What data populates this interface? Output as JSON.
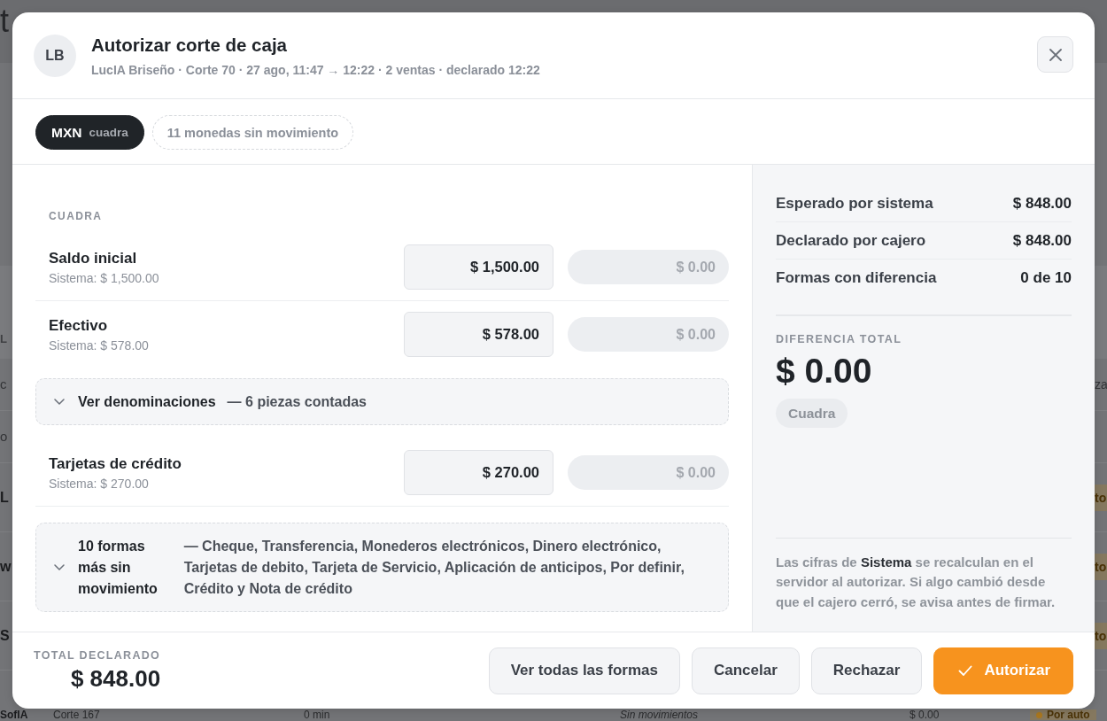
{
  "background_page": {
    "title": "t",
    "column_header": "L",
    "rows": [
      {
        "kind": "plain",
        "name": "c",
        "end": "za"
      },
      {
        "kind": "plain",
        "name": "o"
      },
      {
        "kind": "pending",
        "name": "L",
        "status": "to"
      },
      {
        "kind": "pending",
        "name": "w",
        "status": "to"
      },
      {
        "kind": "pending",
        "name": "S",
        "status": "to"
      },
      {
        "kind": "detailed",
        "name": "SofIA",
        "corte": "Corte 167",
        "duration": "0 min",
        "movements": "Sin movimientos",
        "amount": "$ 0.00",
        "status": "Por auto"
      }
    ]
  },
  "dialog": {
    "avatar": "LB",
    "title": "Autorizar corte de caja",
    "subtitle": "LucIA Briseño · Corte 70 · 27 ago, 11:47 → 12:22 · 2 ventas · declarado 12:22"
  },
  "currency_tabs": [
    {
      "kind": "currency",
      "code": "MXN",
      "status": "cuadra",
      "selected": true
    },
    {
      "kind": "collapsed",
      "label": "11 monedas sin movimiento",
      "selected": false
    }
  ],
  "breakdown": {
    "heading": "CUADRA",
    "items": [
      {
        "kind": "payment",
        "name": "Saldo inicial",
        "system": "Sistema: $ 1,500.00",
        "declared": "$ 1,500.00",
        "difference": "$ 0.00"
      },
      {
        "kind": "payment",
        "name": "Efectivo",
        "system": "Sistema: $ 578.00",
        "declared": "$ 578.00",
        "difference": "$ 0.00",
        "denominations": {
          "title": "Ver denominaciones",
          "summary": "— 6 piezas contadas",
          "expanded": false
        }
      },
      {
        "kind": "payment",
        "name": "Tarjetas de crédito",
        "system": "Sistema: $ 270.00",
        "declared": "$ 270.00",
        "difference": "$ 0.00"
      },
      {
        "kind": "details",
        "title": "10 formas más sin movimiento",
        "summary": "— Cheque, Transferencia, Monederos electrónicos, Dinero electrónico, Tarjetas de debito, Tarjeta de Servicio, Aplicación de anticipos, Por definir, Crédito y Nota de crédito",
        "expanded": false
      }
    ]
  },
  "summary": {
    "rows": [
      {
        "label": "Esperado por sistema",
        "value": "$ 848.00"
      },
      {
        "label": "Declarado por cajero",
        "value": "$ 848.00"
      },
      {
        "label": "Formas con diferencia",
        "value": "0 de 10"
      }
    ],
    "difference_label": "DIFERENCIA TOTAL",
    "difference": "$ 0.00",
    "status": {
      "kind": "balanced",
      "label": "Cuadra"
    },
    "note": "Las cifras de **Sistema** se recalculan en el servidor al autorizar. Si algo cambió desde que el cajero cerró, se avisa antes de firmar."
  },
  "footer": {
    "total_label": "TOTAL DECLARADO",
    "total": "$ 848.00",
    "buttons": [
      {
        "kind": "secondary",
        "label": "Ver todas las formas"
      },
      {
        "kind": "secondary",
        "label": "Cancelar"
      },
      {
        "kind": "secondary",
        "label": "Rechazar"
      },
      {
        "kind": "primary",
        "label": "Autorizar"
      }
    ]
  }
}
